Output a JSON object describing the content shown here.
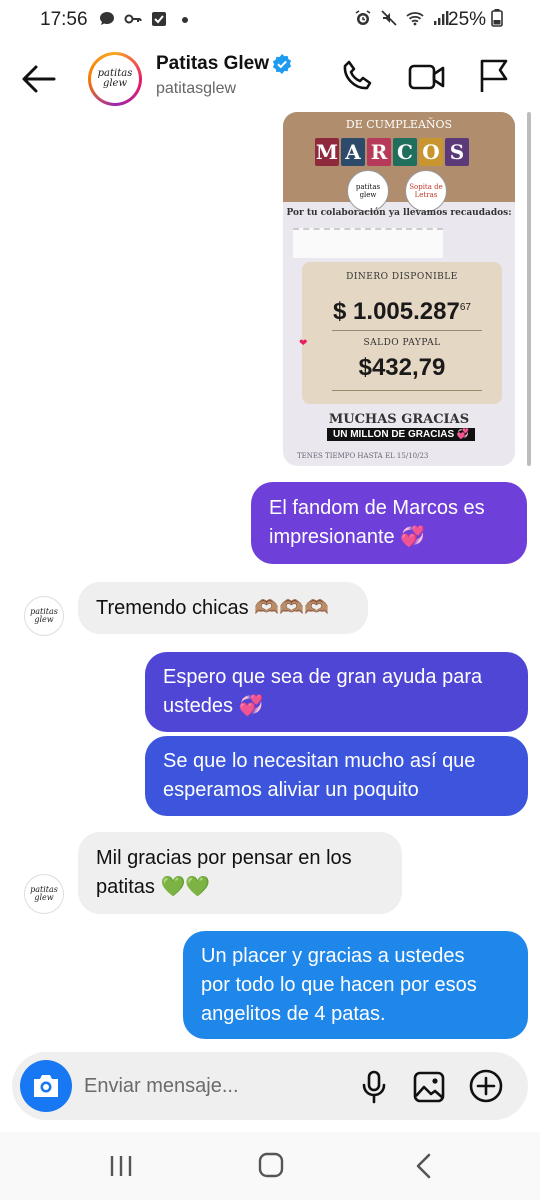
{
  "status_bar": {
    "time": "17:56",
    "battery": "25%"
  },
  "header": {
    "avatar_logo": "patitas glew",
    "name": "Patitas Glew",
    "handle": "patitasglew",
    "icons": [
      "back-arrow-icon",
      "verified-badge-icon",
      "phone-icon",
      "video-icon",
      "flag-icon"
    ]
  },
  "shared_image": {
    "heading": "DE CUMPLEAÑOS",
    "name_letters": [
      "M",
      "A",
      "R",
      "C",
      "O",
      "S"
    ],
    "name_letter_colors": [
      "#8e2a3c",
      "#2e4a6b",
      "#b83a5a",
      "#1f6f5c",
      "#c9952f",
      "#5c3a7a"
    ],
    "logo1": "patitas glew",
    "logo2": "Sopita de Letras",
    "colab_text": "Por tu colaboración ya llevamos recaudados:",
    "card": {
      "label1": "DINERO DISPONIBLE",
      "amount1": "$ 1.005.287",
      "amount1_cents": "67",
      "label2": "SALDO PAYPAL",
      "amount2": "$432,79"
    },
    "muchas_gracias": "MUCHAS GRACIAS",
    "millon": "UN MILLON DE GRACIAS 💞",
    "tenes": "TENES TIEMPO HASTA EL 15/10/23"
  },
  "messages": [
    {
      "from": "me",
      "color": "#6f3fd9",
      "lines": [
        "El fandom de Marcos es",
        "impresionante 💞"
      ]
    },
    {
      "from": "them",
      "lines": [
        "Tremendo chicas 🫶🏽🫶🏽🫶🏽"
      ]
    },
    {
      "from": "me",
      "color": "#4f46d6",
      "lines": [
        "Espero que sea de gran ayuda para",
        "ustedes 💞"
      ]
    },
    {
      "from": "me",
      "color": "#3c55dc",
      "lines": [
        "Se que lo necesitan mucho así que",
        "esperamos aliviar un poquito"
      ]
    },
    {
      "from": "them",
      "lines": [
        "Mil gracias por pensar en los",
        "patitas 💚💚"
      ]
    },
    {
      "from": "me",
      "color": "#1f86ea",
      "lines": [
        "Un placer y gracias a ustedes",
        "por todo lo que hacen por esos",
        "angelitos de 4 patas."
      ]
    }
  ],
  "composer": {
    "placeholder": "Enviar mensaje...",
    "camera_color": "#1877f2",
    "icons": [
      "camera-icon",
      "microphone-icon",
      "gallery-icon",
      "plus-circle-icon"
    ]
  },
  "nav": {
    "icons": [
      "recent-apps-icon",
      "home-icon",
      "back-icon"
    ]
  }
}
